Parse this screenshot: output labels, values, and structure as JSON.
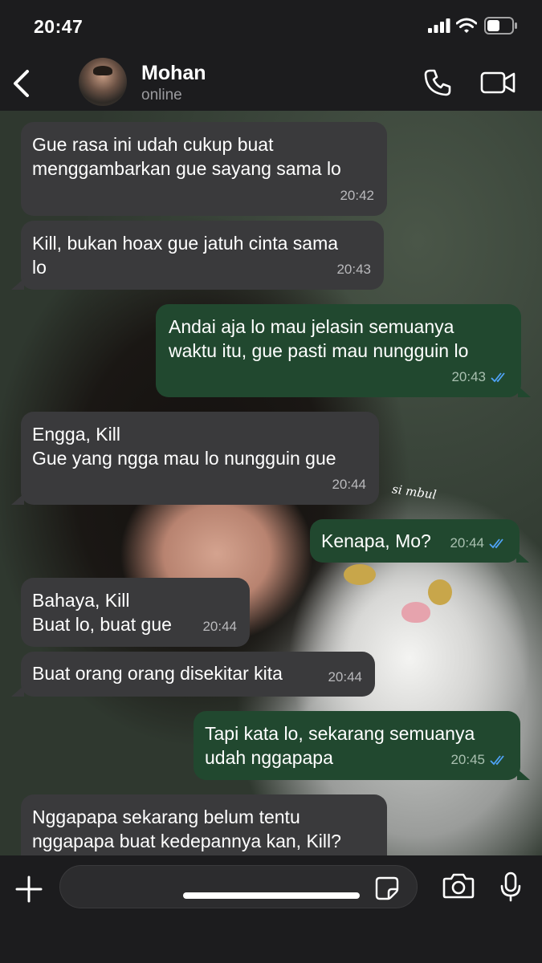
{
  "status_bar": {
    "time": "20:47"
  },
  "header": {
    "contact_name": "Mohan",
    "contact_status": "online"
  },
  "wallpaper": {
    "caption": "si mbul"
  },
  "colors": {
    "incoming_bubble": "#3a3a3c",
    "outgoing_bubble": "#21482f",
    "read_ticks": "#4fa3f7"
  },
  "messages": [
    {
      "direction": "in",
      "text": "Gue rasa ini udah cukup buat\nmenggambarkan gue sayang sama lo",
      "time": "20:42"
    },
    {
      "direction": "in",
      "text": "Kill, bukan hoax gue jatuh cinta sama\nlo",
      "time": "20:43"
    },
    {
      "direction": "out",
      "text": "Andai aja lo mau jelasin semuanya\nwaktu itu, gue pasti mau nungguin lo",
      "time": "20:43",
      "status": "read"
    },
    {
      "direction": "in",
      "text": "Engga, Kill\nGue yang ngga mau lo nungguin gue",
      "time": "20:44"
    },
    {
      "direction": "out",
      "text": "Kenapa, Mo?",
      "time": "20:44",
      "status": "read"
    },
    {
      "direction": "in",
      "text": "Bahaya, Kill\nBuat lo, buat gue",
      "time": "20:44"
    },
    {
      "direction": "in",
      "text": "Buat orang orang disekitar kita",
      "time": "20:44"
    },
    {
      "direction": "out",
      "text": "Tapi kata lo, sekarang semuanya\nudah nggapapa",
      "time": "20:45",
      "status": "read"
    },
    {
      "direction": "in",
      "text": "Nggapapa sekarang belum tentu\nnggapapa buat kedepannya kan, Kill?",
      "time": ""
    }
  ],
  "input": {
    "placeholder": "",
    "value": ""
  },
  "icons": {
    "back": "chevron-left-icon",
    "call": "phone-icon",
    "video": "video-camera-icon",
    "plus": "plus-icon",
    "sticker": "sticker-icon",
    "camera": "camera-icon",
    "mic": "microphone-icon"
  }
}
